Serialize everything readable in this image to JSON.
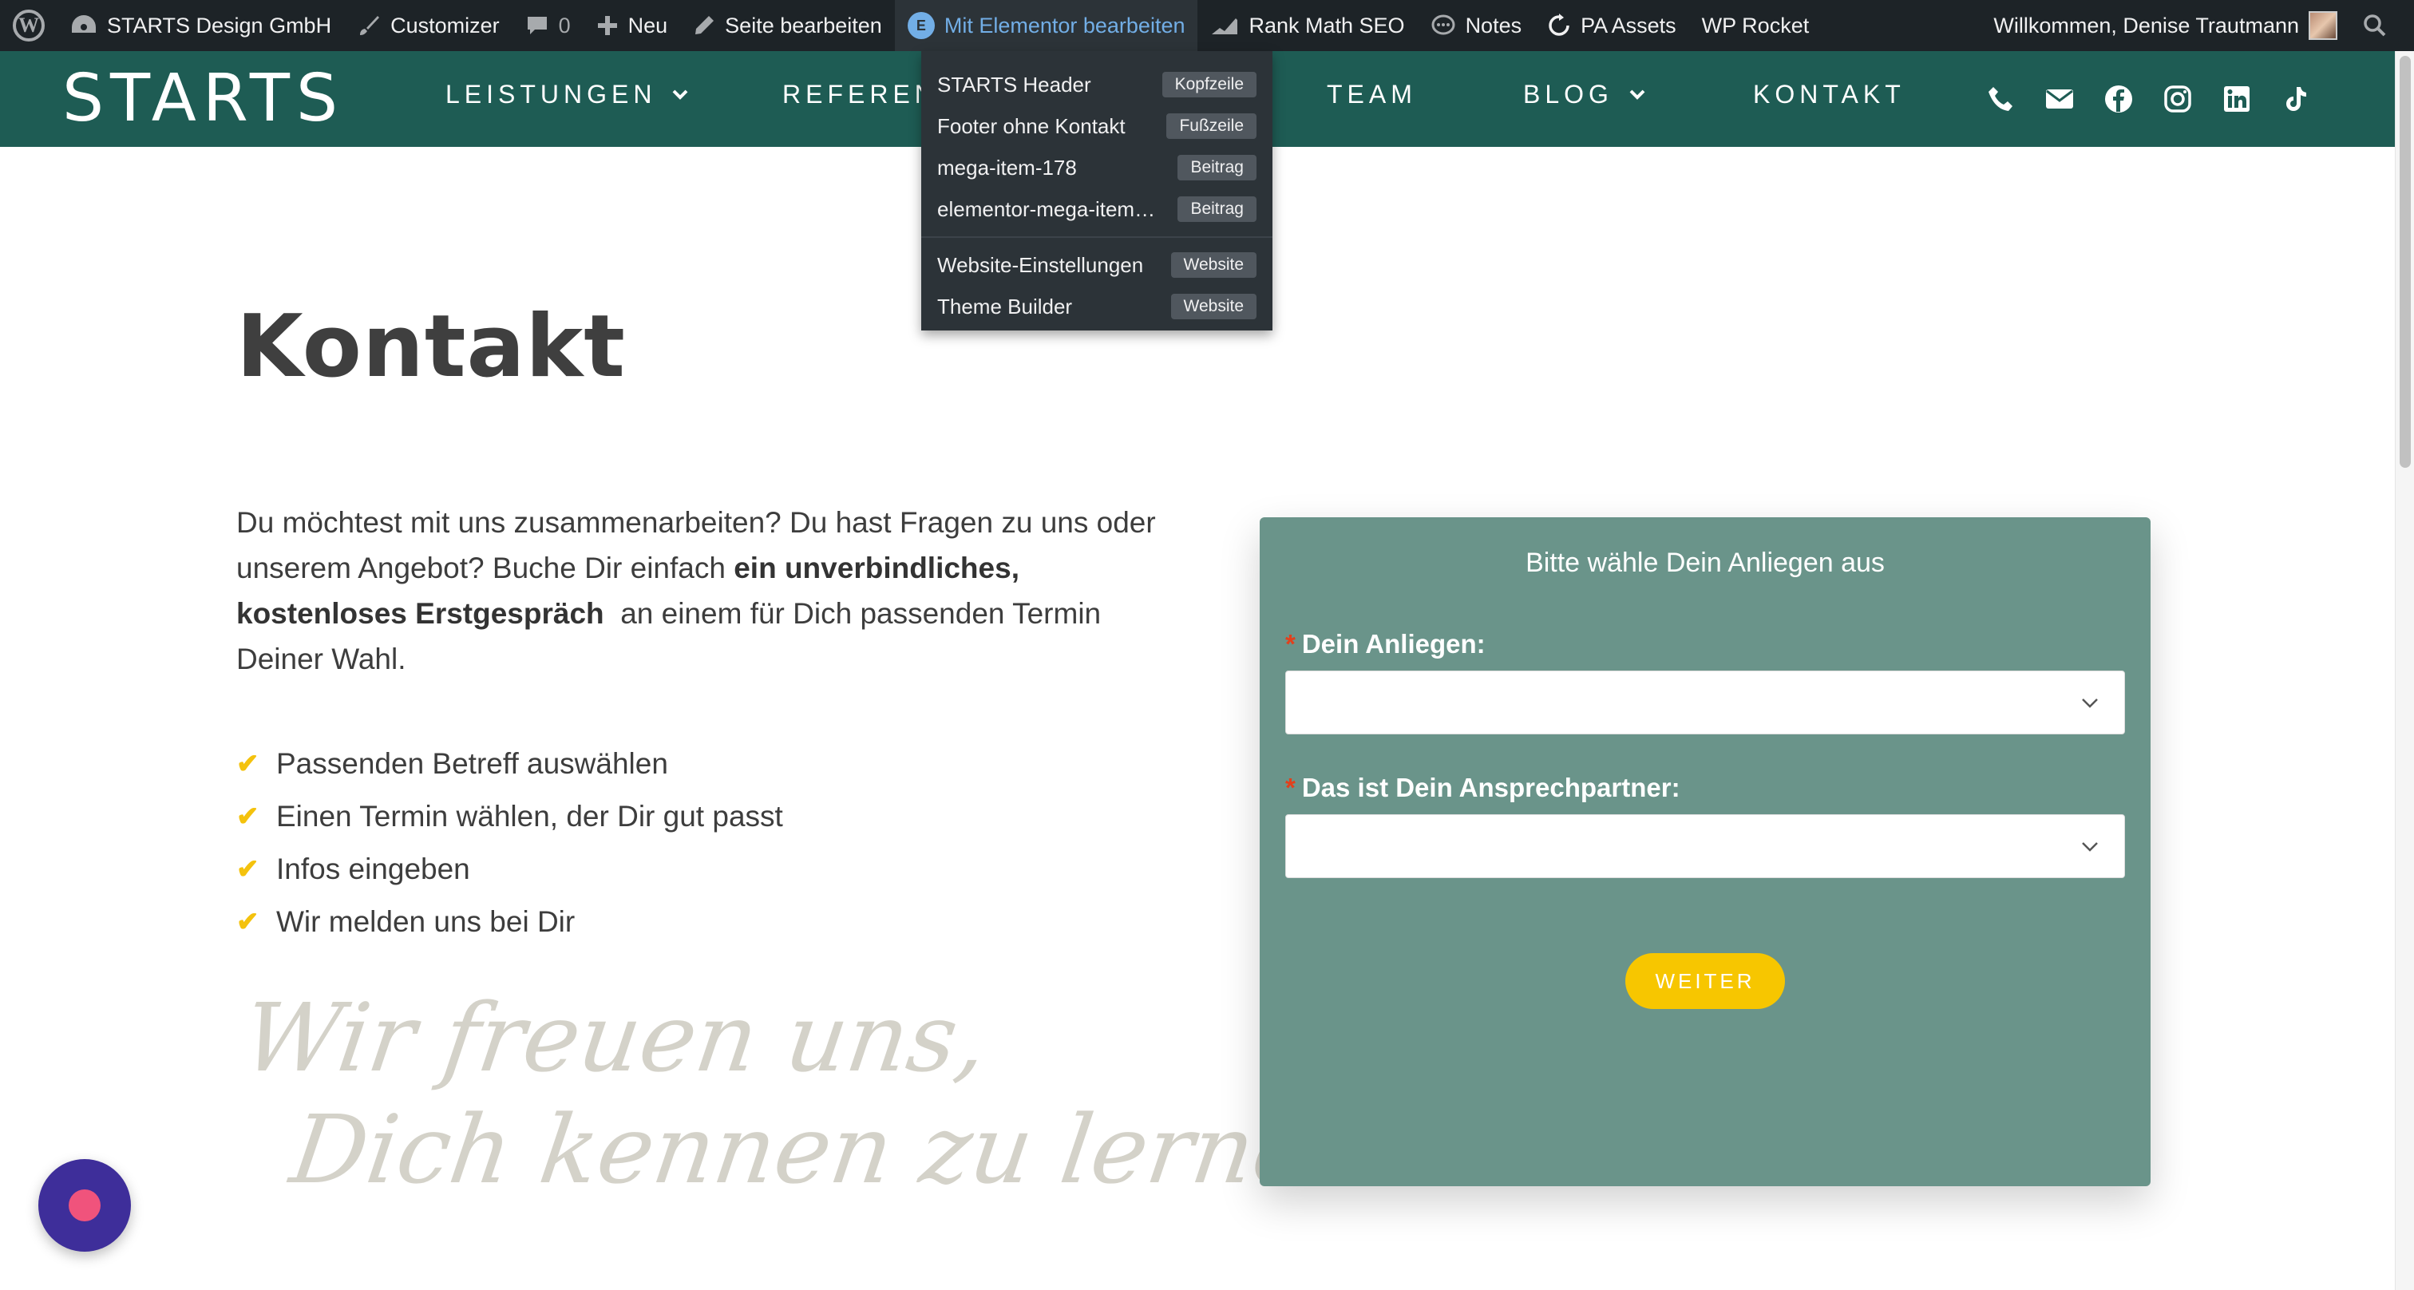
{
  "adminbar": {
    "site_name": "STARTS Design GmbH",
    "customizer": "Customizer",
    "comments_count": "0",
    "new": "Neu",
    "edit_page": "Seite bearbeiten",
    "elementor": "Mit Elementor bearbeiten",
    "rank_math": "Rank Math SEO",
    "notes": "Notes",
    "pa_assets": "PA Assets",
    "wp_rocket": "WP Rocket",
    "welcome": "Willkommen, Denise Trautmann"
  },
  "elementor_menu": {
    "items": [
      {
        "label": "STARTS Header",
        "badge": "Kopfzeile"
      },
      {
        "label": "Footer ohne Kontakt",
        "badge": "Fußzeile"
      },
      {
        "label": "mega-item-178",
        "badge": "Beitrag"
      },
      {
        "label": "elementor-mega-item…",
        "badge": "Beitrag"
      },
      {
        "label": "Website-Einstellungen",
        "badge": "Website"
      },
      {
        "label": "Theme Builder",
        "badge": "Website"
      }
    ]
  },
  "header": {
    "logo": "STARTS",
    "nav": {
      "leistungen": "LEISTUNGEN",
      "referenzen": "REFEREN",
      "team": "TEAM",
      "blog": "BLOG",
      "kontakt": "KONTAKT"
    },
    "bg_color": "#1e5c54"
  },
  "content": {
    "title": "Kontakt",
    "intro_1": "Du möchtest mit uns zusammenarbeiten? Du hast Fragen zu uns oder unserem Angebot? Buche Dir einfach ",
    "intro_bold": "ein unverbindliches, kostenloses Erstgespräch",
    "intro_2": "  an einem für Dich passenden Termin Deiner Wahl.",
    "checklist": [
      "Passenden Betreff auswählen",
      "Einen Termin wählen, der Dir gut passt",
      "Infos eingeben",
      "Wir melden uns bei Dir"
    ],
    "script_line_1": "Wir freuen uns,",
    "script_line_2": "Dich kennen zu lernen!"
  },
  "form": {
    "heading": "Bitte wähle Dein Anliegen aus",
    "field1_label": "Dein Anliegen:",
    "field2_label": "Das ist Dein Ansprechpartner:",
    "required_mark": "*",
    "button": "WEITER",
    "card_color": "#6a948a",
    "button_color": "#f7c600"
  }
}
